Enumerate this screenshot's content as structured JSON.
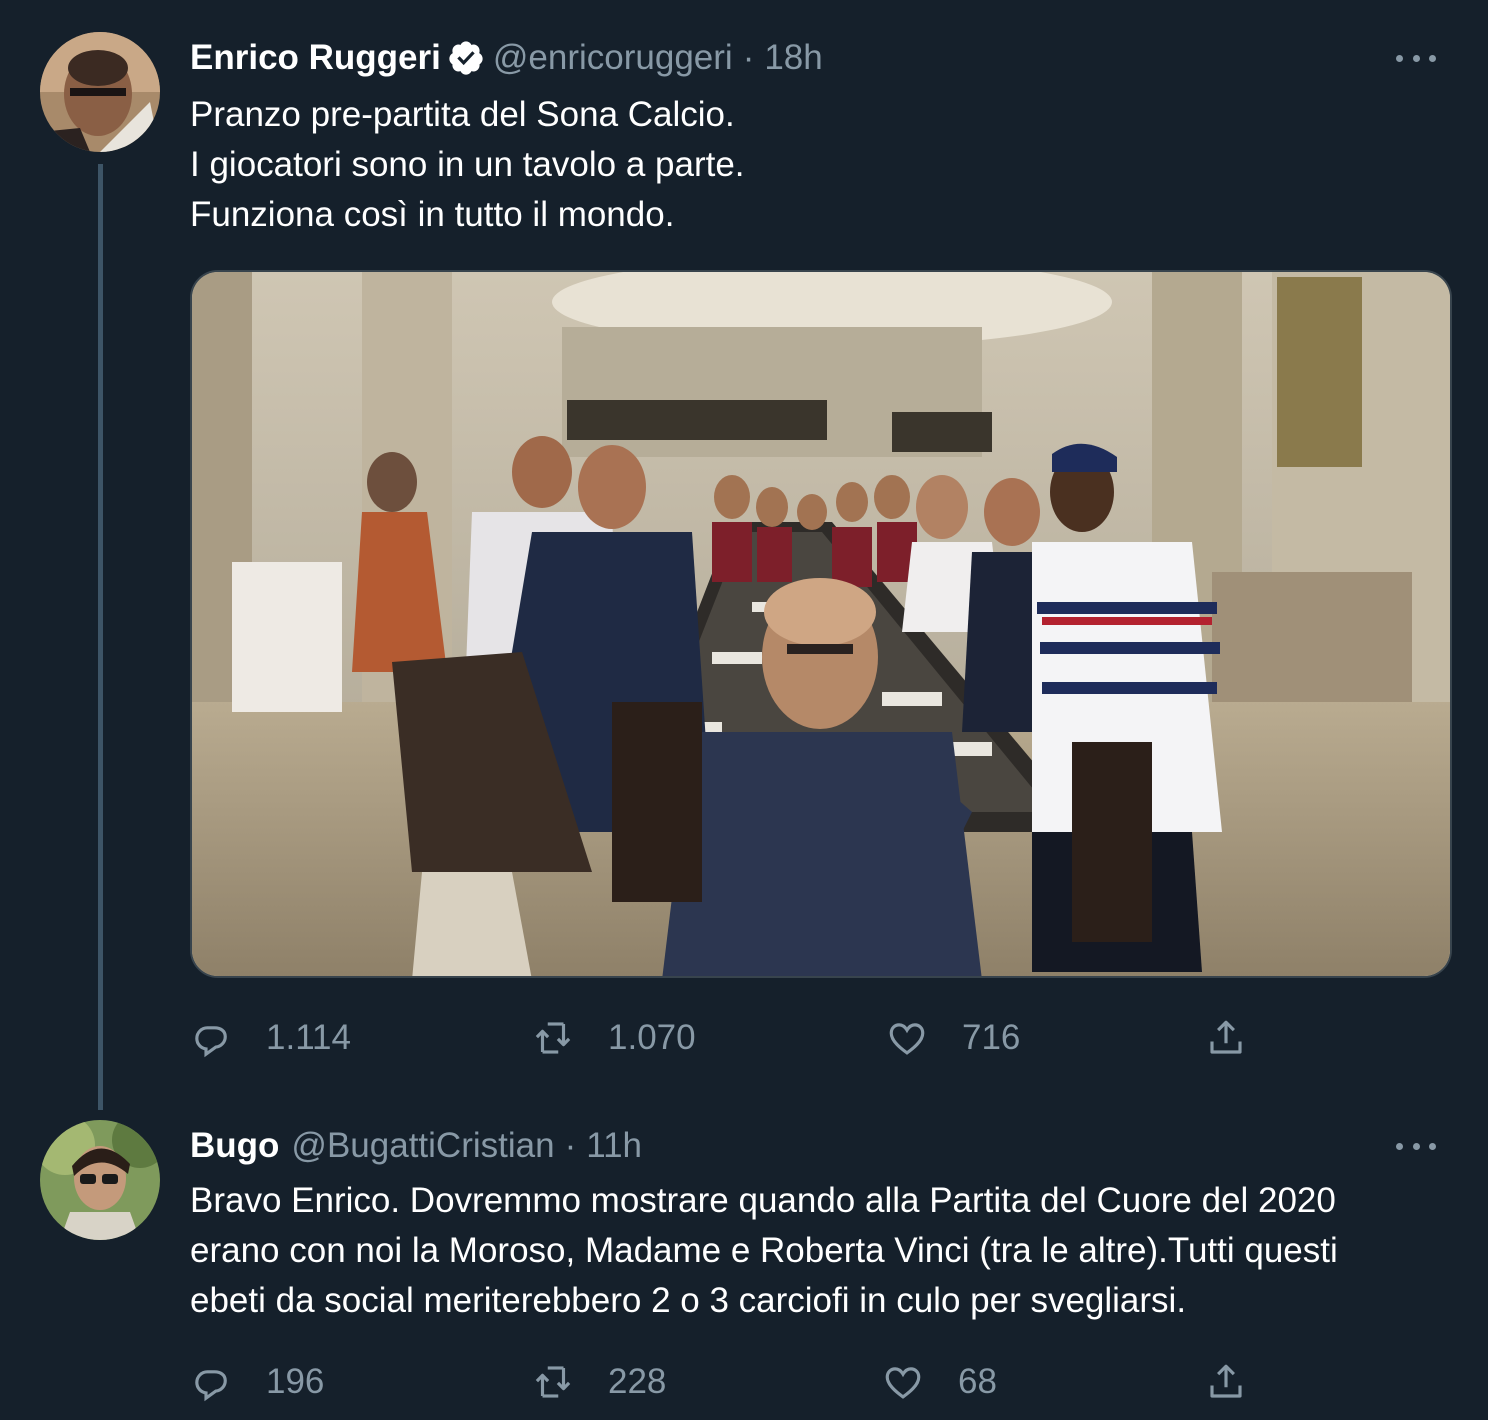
{
  "tweets": [
    {
      "name": "Enrico Ruggeri",
      "handle": "@enricoruggeri",
      "separator": "·",
      "time": "18h",
      "lines": [
        "Pranzo pre-partita del Sona Calcio.",
        "I giocatori sono in un tavolo a parte.",
        "Funziona così in tutto il mondo."
      ],
      "replies": "1.114",
      "retweets": "1.070",
      "likes": "716"
    },
    {
      "name": "Bugo",
      "handle": "@BugattiCristian",
      "separator": "·",
      "time": "11h",
      "lines": [
        "Bravo Enrico. Dovremmo mostrare quando alla Partita del Cuore del 2020",
        "erano con noi la Moroso, Madame e Roberta Vinci (tra le altre).Tutti questi",
        "ebeti da social meriterebbero 2 o 3 carciofi in culo per svegliarsi."
      ],
      "replies": "196",
      "retweets": "228",
      "likes": "68"
    }
  ],
  "colors": {
    "background": "#15202b",
    "secondary_text": "#8899a6",
    "verified": "#ffffff",
    "thread_line": "#3d5466"
  },
  "icons": [
    "verified-badge-icon",
    "more-icon",
    "reply-icon",
    "retweet-icon",
    "like-icon",
    "share-icon"
  ]
}
